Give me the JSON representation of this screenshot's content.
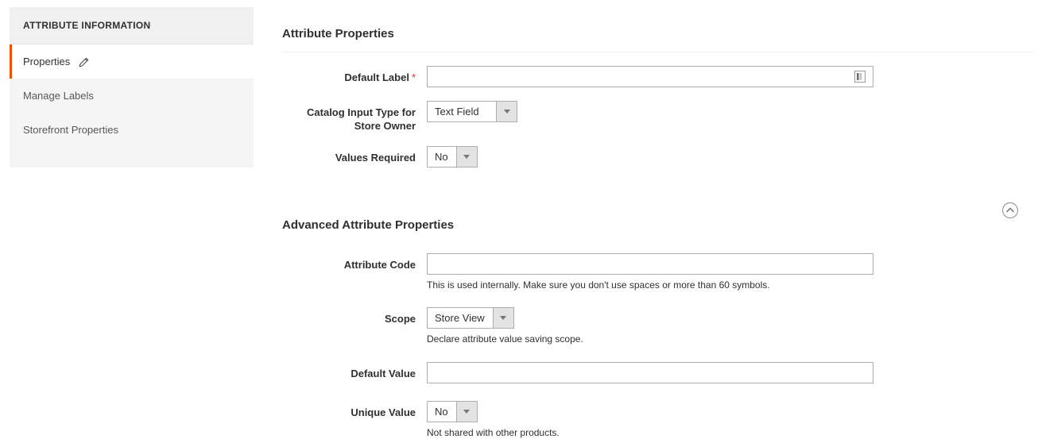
{
  "sidebar": {
    "header": "ATTRIBUTE INFORMATION",
    "items": [
      {
        "label": "Properties",
        "active": true,
        "icon": "pencil-icon"
      },
      {
        "label": "Manage Labels",
        "active": false
      },
      {
        "label": "Storefront Properties",
        "active": false
      }
    ]
  },
  "main": {
    "attribute_properties": {
      "title": "Attribute Properties",
      "fields": {
        "default_label": {
          "label": "Default Label",
          "required_marker": "*",
          "value": "",
          "icon": "store-view-icon"
        },
        "catalog_input_type": {
          "label": "Catalog Input Type for Store Owner",
          "value": "Text Field"
        },
        "values_required": {
          "label": "Values Required",
          "value": "No"
        }
      }
    },
    "advanced_attribute_properties": {
      "title": "Advanced Attribute Properties",
      "collapse_icon": "chevron-up-circle-icon",
      "fields": {
        "attribute_code": {
          "label": "Attribute Code",
          "value": "",
          "note": "This is used internally. Make sure you don't use spaces or more than 60 symbols."
        },
        "scope": {
          "label": "Scope",
          "value": "Store View",
          "note": "Declare attribute value saving scope."
        },
        "default_value": {
          "label": "Default Value",
          "value": "",
          "note": ""
        },
        "unique_value": {
          "label": "Unique Value",
          "value": "No",
          "note": "Not shared with other products."
        }
      }
    }
  },
  "colors": {
    "accent": "#eb5202",
    "required": "#e22626",
    "sidebar_header_bg": "#f0f0f0",
    "sidebar_bg": "#f5f5f5",
    "text": "#303030",
    "border": "#adadad"
  }
}
